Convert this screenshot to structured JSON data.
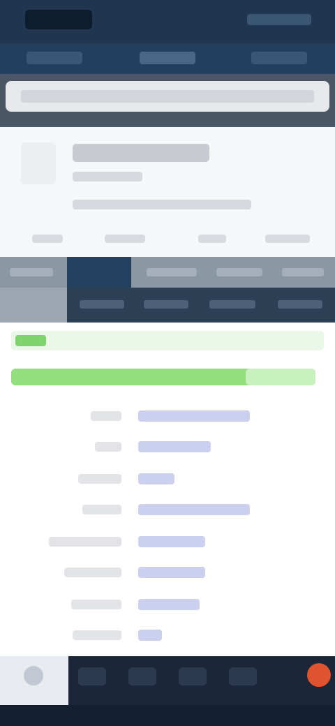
{
  "status_bar": {
    "time": "",
    "signal": ""
  },
  "tabs": [
    {
      "label": ""
    },
    {
      "label": ""
    },
    {
      "label": ""
    }
  ],
  "url_bar": {
    "value": ""
  },
  "page_header": {
    "title": "",
    "subtitle": "",
    "meta": "",
    "links": [
      "",
      "",
      "",
      ""
    ]
  },
  "nav": {
    "items": [
      "",
      "",
      "",
      "",
      ""
    ],
    "active_index": 1
  },
  "subnav": {
    "items": [
      "",
      "",
      "",
      "",
      ""
    ]
  },
  "content": {
    "banner_tag": "",
    "highlight_text": "",
    "rows": [
      {
        "key": "",
        "value": ""
      },
      {
        "key": "",
        "value": ""
      },
      {
        "key": "",
        "value": ""
      },
      {
        "key": "",
        "value": ""
      },
      {
        "key": "",
        "value": ""
      },
      {
        "key": "",
        "value": ""
      },
      {
        "key": "",
        "value": ""
      },
      {
        "key": "",
        "value": ""
      }
    ]
  },
  "bottom_bar": {
    "icons": [
      "home-icon",
      "item-icon",
      "item-icon",
      "item-icon",
      "item-icon",
      "alert-icon"
    ]
  },
  "colors": {
    "header_bg": "#1f3550",
    "accent_green": "#94e07f",
    "link_blue": "#cbd0ee",
    "alert_orange": "#e0532f"
  }
}
